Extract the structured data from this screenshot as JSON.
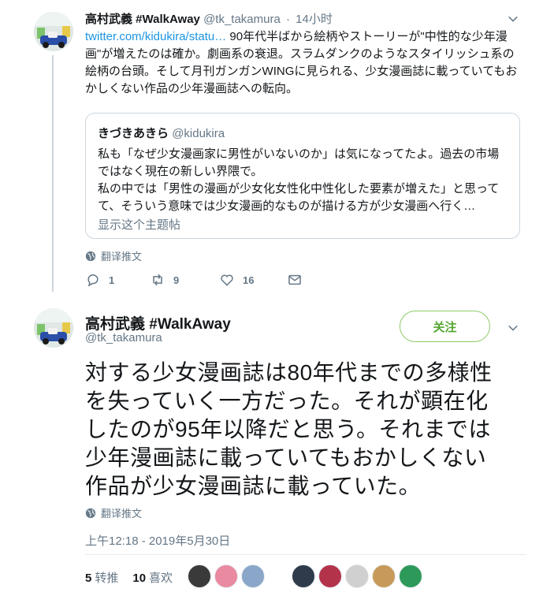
{
  "colors": {
    "link": "#1b95e0",
    "secondary_text": "#657786",
    "follow_green": "#55a630",
    "border": "#ccd6dd"
  },
  "parent_tweet": {
    "display_name": "高村武義 #WalkAway",
    "handle": "@tk_takamura",
    "separator": "·",
    "time": "14小时",
    "link_text": "twitter.com/kidukira/statu…",
    "text": " 90年代半ばから絵柄やストーリーが\"中性的な少年漫画\"が増えたのは確か。劇画系の衰退。スラムダンクのようなスタイリッシュ系の絵柄の台頭。そして月刊ガンガンWINGに見られる、少女漫画誌に載っていてもおかしくない作品の少年漫画誌への転向。",
    "quoted": {
      "display_name": "きづきあきら",
      "handle": "@kidukira",
      "text_lines": [
        "私も「なぜ少女漫画家に男性がいないのか」は気になってたよ。過去の市場",
        "ではなく現在の新しい界隈で。",
        "私の中では「男性の漫画が少女化女性化中性化した要素が増えた」と思って",
        "て、そういう意味では少女漫画的なものが描ける方が少女漫画へ行く…"
      ],
      "show_thread": "显示这个主题帖"
    },
    "translate_label": "翻译推文",
    "actions": {
      "reply_count": "1",
      "retweet_count": "9",
      "like_count": "16",
      "icons": [
        "reply-icon",
        "retweet-icon",
        "heart-icon",
        "message-icon"
      ]
    }
  },
  "main_tweet": {
    "display_name": "高村武義 #WalkAway",
    "handle": "@tk_takamura",
    "follow_label": "关注",
    "lines": [
      "対する少女漫画誌は80年代までの多様性",
      "を失っていく一方だった。それが顕在化",
      "したのが95年以降だと思う。それまでは",
      "少年漫画誌に載っていてもおかしくない",
      "作品が少女漫画誌に載っていた。"
    ],
    "translate_label": "翻译推文",
    "timestamp": "上午12:18 - 2019年5月30日",
    "retweet_count": "5",
    "retweet_label": "转推",
    "like_count": "10",
    "like_label": "喜欢",
    "liker_colors": [
      "#3a3a3a",
      "#e98aa0",
      "#8aa6c8",
      "#2f3b4a",
      "#b3334a",
      "#d0d0d0",
      "#c89a5a",
      "#2e9a5a"
    ]
  }
}
